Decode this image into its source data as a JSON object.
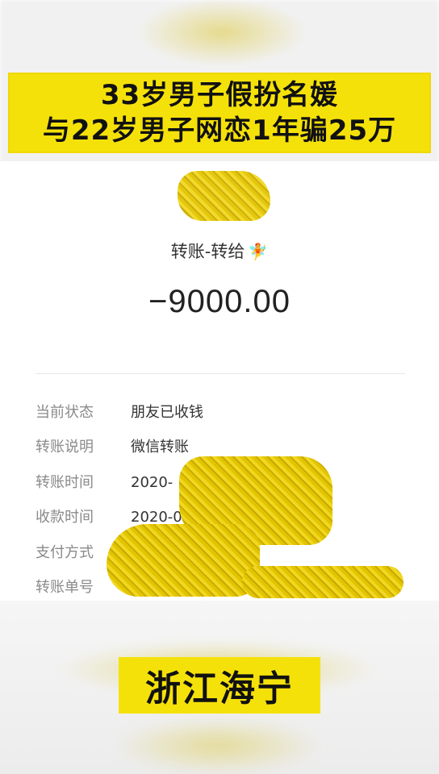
{
  "headline": {
    "line1": "33岁男子假扮名媛",
    "line2": "与22岁男子网恋1年骗25万"
  },
  "transfer": {
    "title": "转账-转给",
    "recipient_icon": "fairy-emoji",
    "recipient_glyph": "🧚",
    "amount": "−9000.00"
  },
  "details": [
    {
      "label": "当前状态",
      "value": "朋友已收钱"
    },
    {
      "label": "转账说明",
      "value": "微信转账"
    },
    {
      "label": "转账时间",
      "value": "2020-"
    },
    {
      "label": "收款时间",
      "value": "2020-0"
    },
    {
      "label": "支付方式",
      "value": ""
    },
    {
      "label": "转账单号",
      "value": ""
    }
  ],
  "location": "浙江海宁",
  "colors": {
    "banner": "#f5e10a",
    "scribble": "#e2c400"
  }
}
